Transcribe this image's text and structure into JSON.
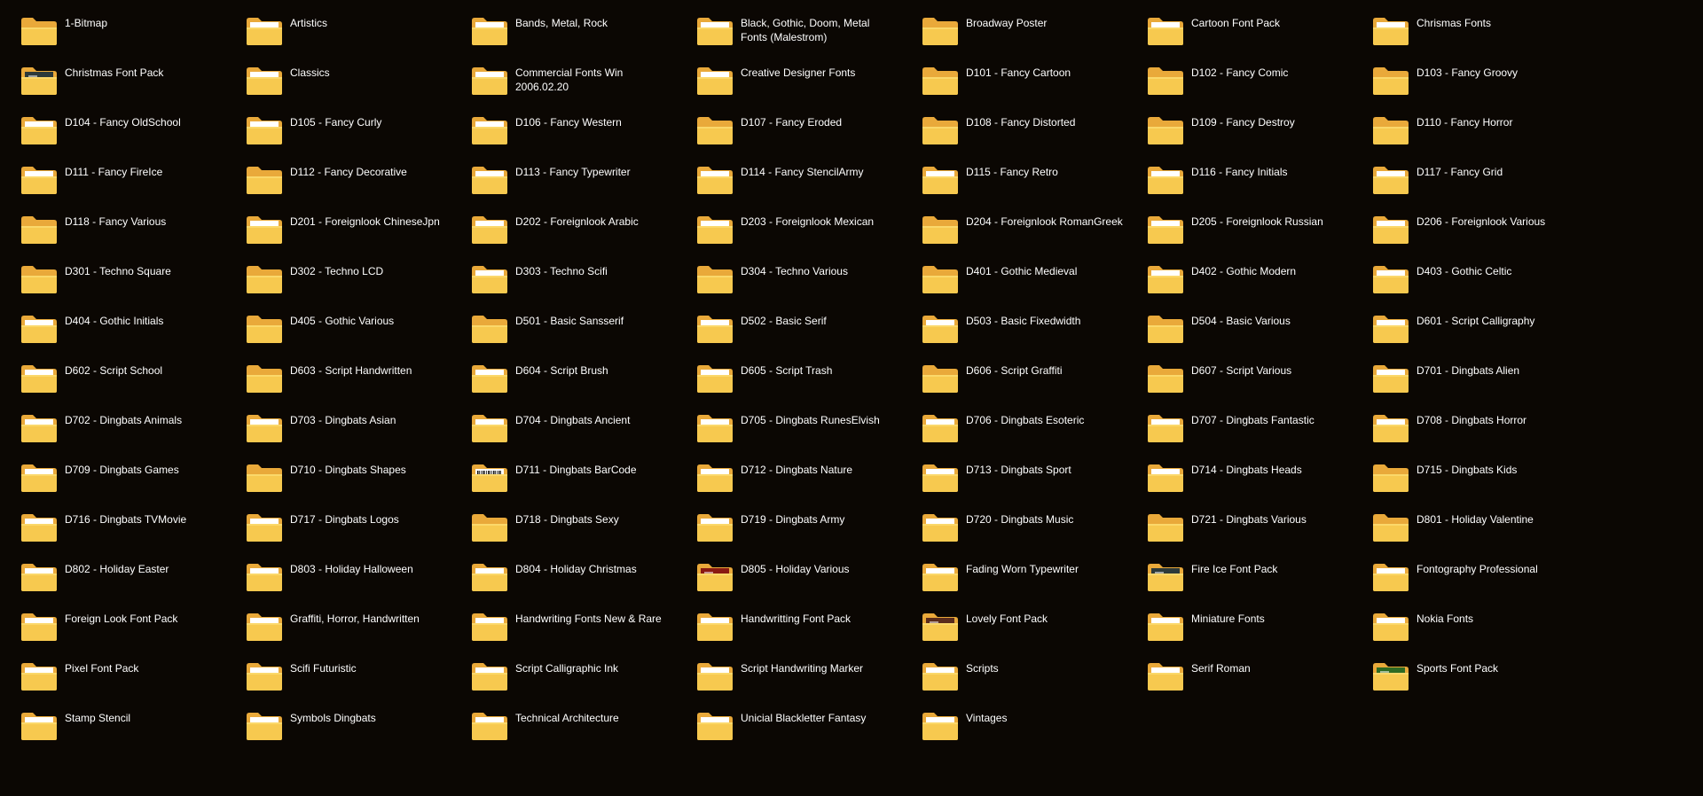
{
  "view": {
    "mode": "large-icons"
  },
  "colors": {
    "background": "#0b0703",
    "folder_back": "#e9a93a",
    "folder_front": "#f7c94f",
    "folder_front_light": "#fbd86a",
    "label": "#ffffff"
  },
  "folders": [
    {
      "name": "1-Bitmap",
      "preview": "none"
    },
    {
      "name": "Artistics",
      "preview": "paper"
    },
    {
      "name": "Bands, Metal, Rock",
      "preview": "paper"
    },
    {
      "name": "Black, Gothic, Doom, Metal Fonts (Malestrom)",
      "preview": "paper"
    },
    {
      "name": "Broadway Poster",
      "preview": "none"
    },
    {
      "name": "Cartoon Font Pack",
      "preview": "paper"
    },
    {
      "name": "Chrismas Fonts",
      "preview": "paper"
    },
    {
      "name": "Christmas Font Pack",
      "preview": "dark-image"
    },
    {
      "name": "Classics",
      "preview": "paper"
    },
    {
      "name": "Commercial Fonts Win 2006.02.20",
      "preview": "paper"
    },
    {
      "name": "Creative Designer Fonts",
      "preview": "paper"
    },
    {
      "name": "D101 - Fancy Cartoon",
      "preview": "none"
    },
    {
      "name": "D102 - Fancy Comic",
      "preview": "none"
    },
    {
      "name": "D103 - Fancy Groovy",
      "preview": "none"
    },
    {
      "name": "D104 - Fancy OldSchool",
      "preview": "paper"
    },
    {
      "name": "D105 - Fancy Curly",
      "preview": "paper"
    },
    {
      "name": "D106 - Fancy Western",
      "preview": "paper"
    },
    {
      "name": "D107 - Fancy Eroded",
      "preview": "none"
    },
    {
      "name": "D108 - Fancy Distorted",
      "preview": "none"
    },
    {
      "name": "D109 - Fancy Destroy",
      "preview": "none"
    },
    {
      "name": "D110 - Fancy Horror",
      "preview": "none"
    },
    {
      "name": "D111 - Fancy FireIce",
      "preview": "paper"
    },
    {
      "name": "D112 - Fancy Decorative",
      "preview": "none"
    },
    {
      "name": "D113 - Fancy Typewriter",
      "preview": "paper"
    },
    {
      "name": "D114 - Fancy StencilArmy",
      "preview": "paper"
    },
    {
      "name": "D115 - Fancy Retro",
      "preview": "paper"
    },
    {
      "name": "D116 - Fancy Initials",
      "preview": "paper"
    },
    {
      "name": "D117 - Fancy Grid",
      "preview": "paper"
    },
    {
      "name": "D118 - Fancy Various",
      "preview": "none"
    },
    {
      "name": "D201 - Foreignlook ChineseJpn",
      "preview": "paper"
    },
    {
      "name": "D202 - Foreignlook Arabic",
      "preview": "paper"
    },
    {
      "name": "D203 - Foreignlook Mexican",
      "preview": "paper"
    },
    {
      "name": "D204 - Foreignlook RomanGreek",
      "preview": "none"
    },
    {
      "name": "D205 - Foreignlook Russian",
      "preview": "paper"
    },
    {
      "name": "D206 - Foreignlook Various",
      "preview": "paper"
    },
    {
      "name": "D301 - Techno Square",
      "preview": "none"
    },
    {
      "name": "D302 - Techno LCD",
      "preview": "none"
    },
    {
      "name": "D303 - Techno Scifi",
      "preview": "paper"
    },
    {
      "name": "D304 - Techno Various",
      "preview": "none"
    },
    {
      "name": "D401 - Gothic Medieval",
      "preview": "none"
    },
    {
      "name": "D402 - Gothic Modern",
      "preview": "paper"
    },
    {
      "name": "D403 - Gothic Celtic",
      "preview": "paper"
    },
    {
      "name": "D404 - Gothic Initials",
      "preview": "paper"
    },
    {
      "name": "D405 - Gothic Various",
      "preview": "none"
    },
    {
      "name": "D501 - Basic Sansserif",
      "preview": "none"
    },
    {
      "name": "D502 - Basic Serif",
      "preview": "paper"
    },
    {
      "name": "D503 - Basic Fixedwidth",
      "preview": "paper"
    },
    {
      "name": "D504 - Basic Various",
      "preview": "none"
    },
    {
      "name": "D601 - Script Calligraphy",
      "preview": "paper"
    },
    {
      "name": "D602 - Script School",
      "preview": "paper"
    },
    {
      "name": "D603 - Script Handwritten",
      "preview": "none"
    },
    {
      "name": "D604 - Script Brush",
      "preview": "paper"
    },
    {
      "name": "D605 - Script Trash",
      "preview": "paper"
    },
    {
      "name": "D606 - Script Graffiti",
      "preview": "none"
    },
    {
      "name": "D607 - Script Various",
      "preview": "none"
    },
    {
      "name": "D701 - Dingbats Alien",
      "preview": "paper"
    },
    {
      "name": "D702 - Dingbats Animals",
      "preview": "paper"
    },
    {
      "name": "D703 - Dingbats Asian",
      "preview": "paper"
    },
    {
      "name": "D704 - Dingbats Ancient",
      "preview": "paper"
    },
    {
      "name": "D705 - Dingbats RunesElvish",
      "preview": "paper"
    },
    {
      "name": "D706 - Dingbats Esoteric",
      "preview": "paper"
    },
    {
      "name": "D707 - Dingbats Fantastic",
      "preview": "paper"
    },
    {
      "name": "D708 - Dingbats Horror",
      "preview": "paper"
    },
    {
      "name": "D709 - Dingbats Games",
      "preview": "paper"
    },
    {
      "name": "D710 - Dingbats Shapes",
      "preview": "none"
    },
    {
      "name": "D711 - Dingbats BarCode",
      "preview": "barcode"
    },
    {
      "name": "D712 - Dingbats Nature",
      "preview": "paper"
    },
    {
      "name": "D713 - Dingbats Sport",
      "preview": "paper"
    },
    {
      "name": "D714 - Dingbats Heads",
      "preview": "paper"
    },
    {
      "name": "D715 - Dingbats Kids",
      "preview": "none"
    },
    {
      "name": "D716 - Dingbats TVMovie",
      "preview": "paper"
    },
    {
      "name": "D717 - Dingbats Logos",
      "preview": "paper"
    },
    {
      "name": "D718 - Dingbats Sexy",
      "preview": "none"
    },
    {
      "name": "D719 - Dingbats Army",
      "preview": "paper"
    },
    {
      "name": "D720 - Dingbats Music",
      "preview": "paper"
    },
    {
      "name": "D721 - Dingbats Various",
      "preview": "none"
    },
    {
      "name": "D801 - Holiday Valentine",
      "preview": "none"
    },
    {
      "name": "D802 - Holiday Easter",
      "preview": "paper"
    },
    {
      "name": "D803 - Holiday Halloween",
      "preview": "paper"
    },
    {
      "name": "D804 - Holiday Christmas",
      "preview": "paper"
    },
    {
      "name": "D805 - Holiday Various",
      "preview": "red-image"
    },
    {
      "name": "Fading Worn Typewriter",
      "preview": "paper"
    },
    {
      "name": "Fire Ice Font Pack",
      "preview": "dark-image"
    },
    {
      "name": "Fontography Professional",
      "preview": "paper"
    },
    {
      "name": "Foreign Look Font Pack",
      "preview": "paper"
    },
    {
      "name": "Graffiti, Horror, Handwritten",
      "preview": "paper"
    },
    {
      "name": "Handwriting Fonts   New & Rare",
      "preview": "paper"
    },
    {
      "name": "Handwritting Font Pack",
      "preview": "paper"
    },
    {
      "name": "Lovely Font Pack",
      "preview": "brown-image"
    },
    {
      "name": "Miniature Fonts",
      "preview": "paper"
    },
    {
      "name": "Nokia Fonts",
      "preview": "paper"
    },
    {
      "name": "Pixel Font Pack",
      "preview": "paper"
    },
    {
      "name": "Scifi Futuristic",
      "preview": "paper"
    },
    {
      "name": "Script Calligraphic Ink",
      "preview": "paper"
    },
    {
      "name": "Script Handwriting Marker",
      "preview": "paper"
    },
    {
      "name": "Scripts",
      "preview": "paper"
    },
    {
      "name": "Serif Roman",
      "preview": "paper"
    },
    {
      "name": "Sports Font Pack",
      "preview": "green-image"
    },
    {
      "name": "Stamp Stencil",
      "preview": "paper"
    },
    {
      "name": "Symbols Dingbats",
      "preview": "paper"
    },
    {
      "name": "Technical Architecture",
      "preview": "paper"
    },
    {
      "name": "Unicial Blackletter Fantasy",
      "preview": "paper"
    },
    {
      "name": "Vintages",
      "preview": "paper"
    }
  ]
}
